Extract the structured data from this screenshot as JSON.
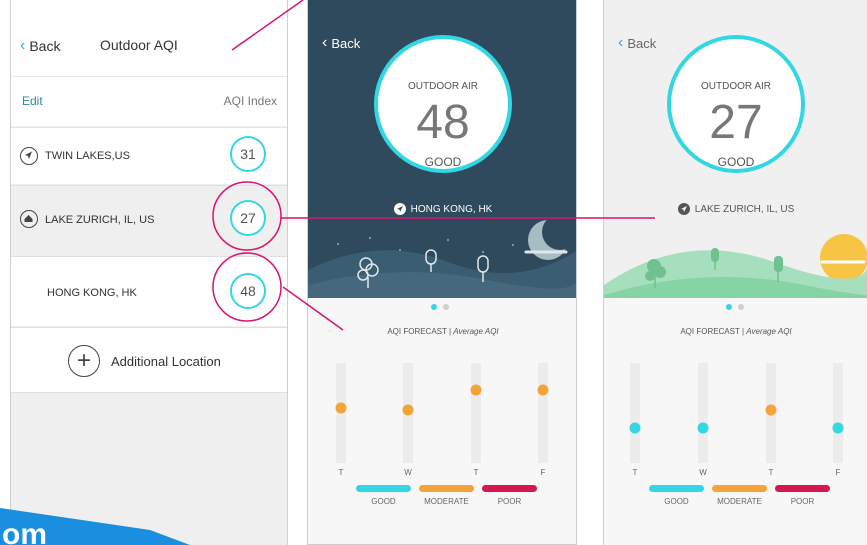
{
  "colors": {
    "accent_cyan": "#33d6e3",
    "magenta": "#d8126f",
    "night_sky": "#2e4a5c",
    "night_hills": "#3a5c70",
    "sun_yellow": "#f7c444",
    "day_hills": "#86d3a5",
    "forecast_orange": "#f4a338",
    "poor_red": "#d8164f",
    "bar_gray": "#ececec",
    "list_gray_bg": "#efefef",
    "brand_blue": "#1a8fe0"
  },
  "left": {
    "back_label": "Back",
    "title": "Outdoor AQI",
    "edit_label": "Edit",
    "column_label": "AQI Index",
    "locations": [
      {
        "name": "TWIN LAKES,US",
        "aqi": "31",
        "icon": "navigation-arrow-icon"
      },
      {
        "name": "LAKE ZURICH, IL, US",
        "aqi": "27",
        "icon": "home-icon"
      },
      {
        "name": "HONG KONG, HK",
        "aqi": "48",
        "icon": ""
      }
    ],
    "add_label": "Additional Location"
  },
  "middle": {
    "back_label": "Back",
    "outdoor_label": "OUTDOOR AIR",
    "aqi_value": "48",
    "status": "GOOD",
    "location": "HONG KONG, HK",
    "forecast_title": "AQI FORECAST",
    "forecast_subtitle": "Average AQI",
    "page_dots": 2,
    "active_dot": 0
  },
  "right": {
    "back_label": "Back",
    "outdoor_label": "OUTDOOR AIR",
    "aqi_value": "27",
    "status": "GOOD",
    "location": "LAKE ZURICH, IL, US",
    "forecast_title": "AQI FORECAST",
    "forecast_subtitle": "Average AQI",
    "page_dots": 2,
    "active_dot": 0
  },
  "chart_data": [
    {
      "type": "bar",
      "title": "AQI FORECAST",
      "subtitle": "Average AQI",
      "categories": [
        "T",
        "W",
        "T",
        "F"
      ],
      "values": [
        55,
        53,
        73,
        73
      ],
      "point_colors": [
        "#f4a338",
        "#f4a338",
        "#f4a338",
        "#f4a338"
      ],
      "ylim": [
        0,
        100
      ],
      "legend": [
        "GOOD",
        "MODERATE",
        "POOR"
      ],
      "legend_colors": [
        "#33d6e3",
        "#f4a338",
        "#d8164f"
      ]
    },
    {
      "type": "bar",
      "title": "AQI FORECAST",
      "subtitle": "Average AQI",
      "categories": [
        "T",
        "W",
        "T",
        "F"
      ],
      "values": [
        35,
        35,
        53,
        35
      ],
      "point_colors": [
        "#33d6e3",
        "#33d6e3",
        "#f4a338",
        "#33d6e3"
      ],
      "ylim": [
        0,
        100
      ],
      "legend": [
        "GOOD",
        "MODERATE",
        "POOR"
      ],
      "legend_colors": [
        "#33d6e3",
        "#f4a338",
        "#d8164f"
      ]
    }
  ],
  "watermark": "om"
}
